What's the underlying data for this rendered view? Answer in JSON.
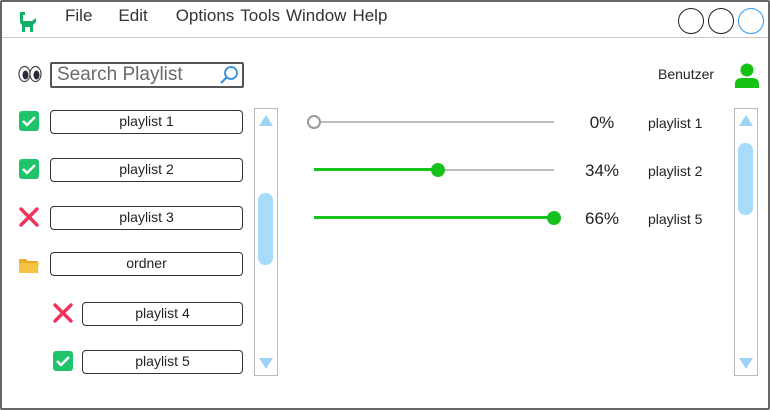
{
  "menu": {
    "file": "File",
    "edit": "Edit",
    "options": "Options",
    "tools": "Tools",
    "window": "Window",
    "help": "Help"
  },
  "search": {
    "placeholder": "Search Playlist"
  },
  "user": {
    "label": "Benutzer",
    "icon": "user-icon",
    "color": "#14c214"
  },
  "playlists": [
    {
      "label": "playlist 1",
      "state": "checked"
    },
    {
      "label": "playlist 2",
      "state": "checked"
    },
    {
      "label": "playlist 3",
      "state": "excluded"
    },
    {
      "label": "ordner",
      "state": "folder"
    },
    {
      "label": "playlist 4",
      "state": "excluded"
    },
    {
      "label": "playlist 5",
      "state": "checked"
    }
  ],
  "mix": [
    {
      "percent": 0,
      "percent_label": "0%",
      "name": "playlist 1"
    },
    {
      "percent": 34,
      "percent_label": "34%",
      "name": "playlist 2"
    },
    {
      "percent": 66,
      "percent_label": "66%",
      "name": "playlist 5"
    }
  ],
  "colors": {
    "accent_green": "#18c21c",
    "check_green": "#1fc46a",
    "excluded_red": "#f0325a",
    "folder_yellow": "#f5c242",
    "scroll_blue": "#a9dcfa",
    "active_window_btn": "#3399ee"
  }
}
